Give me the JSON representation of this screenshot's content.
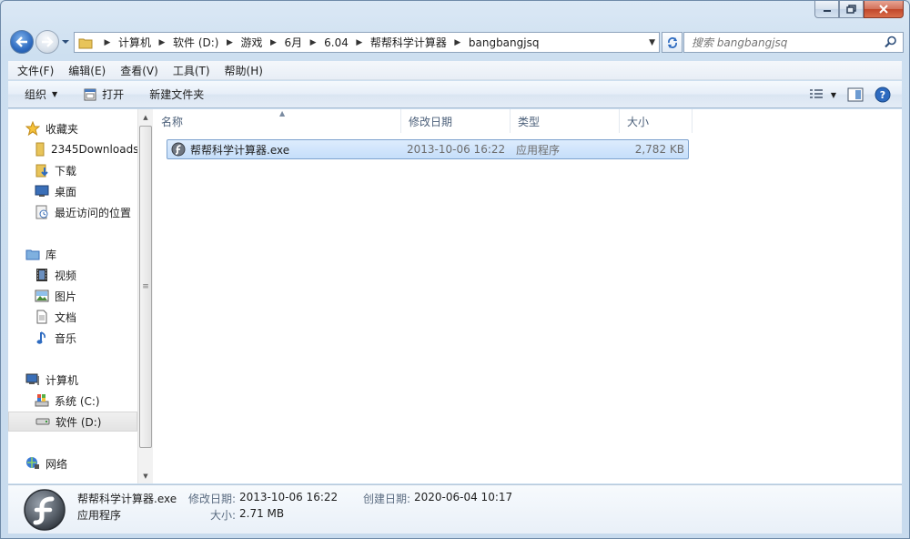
{
  "window": {
    "caption": {
      "minimize": "minimize",
      "maximize": "maximize",
      "close": "close"
    }
  },
  "address": {
    "crumbs": [
      "计算机",
      "软件 (D:)",
      "游戏",
      "6月",
      "6.04",
      "帮帮科学计算器",
      "bangbangjsq"
    ]
  },
  "search": {
    "placeholder": "搜索 bangbangjsq"
  },
  "menu": {
    "items": [
      "文件(F)",
      "编辑(E)",
      "查看(V)",
      "工具(T)",
      "帮助(H)"
    ]
  },
  "toolbar": {
    "organize": "组织",
    "open": "打开",
    "new_folder": "新建文件夹"
  },
  "nav": {
    "favorites": "收藏夹",
    "downloads_2345": "2345Downloads",
    "downloads": "下载",
    "desktop": "桌面",
    "recent": "最近访问的位置",
    "libraries": "库",
    "videos": "视频",
    "pictures": "图片",
    "documents": "文档",
    "music": "音乐",
    "computer": "计算机",
    "drive_c": "系统 (C:)",
    "drive_d": "软件 (D:)",
    "network": "网络"
  },
  "columns": {
    "name": "名称",
    "modified": "修改日期",
    "type": "类型",
    "size": "大小"
  },
  "files": [
    {
      "name": "帮帮科学计算器.exe",
      "modified": "2013-10-06 16:22",
      "type": "应用程序",
      "size": "2,782 KB"
    }
  ],
  "details": {
    "filename": "帮帮科学计算器.exe",
    "filetype": "应用程序",
    "modified_label": "修改日期:",
    "modified_value": "2013-10-06 16:22",
    "created_label": "创建日期:",
    "created_value": "2020-06-04 10:17",
    "size_label": "大小:",
    "size_value": "2.71 MB"
  },
  "colors": {
    "selection": "#c5defa",
    "selection_border": "#7da2ce",
    "frame": "#cddff0"
  }
}
